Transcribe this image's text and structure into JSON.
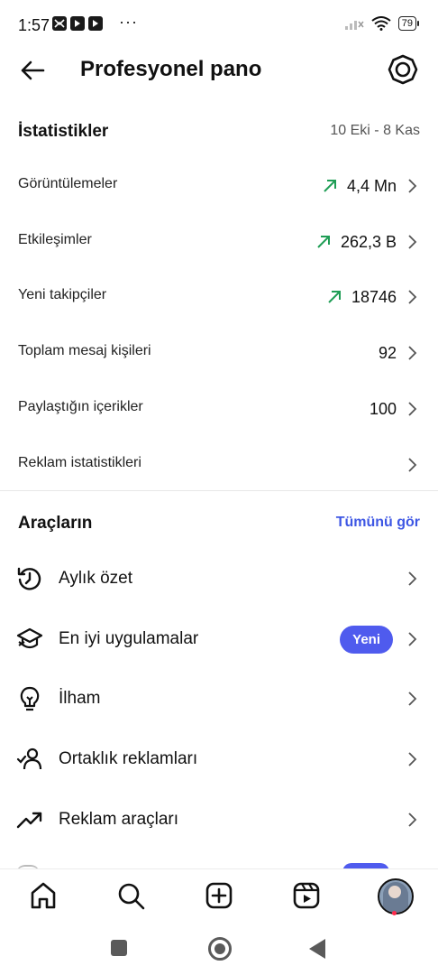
{
  "status_bar": {
    "time": "1:57",
    "dots": "···",
    "battery": "79"
  },
  "header": {
    "title": "Profesyonel pano"
  },
  "stats": {
    "title": "İstatistikler",
    "date_range": "10 Eki - 8 Kas",
    "rows": [
      {
        "label": "Görüntülemeler",
        "value": "4,4 Mn",
        "trend": "up"
      },
      {
        "label": "Etkileşimler",
        "value": "262,3 B",
        "trend": "up"
      },
      {
        "label": "Yeni takipçiler",
        "value": "18746",
        "trend": "up"
      },
      {
        "label": "Toplam mesaj kişileri",
        "value": "92",
        "trend": ""
      },
      {
        "label": "Paylaştığın içerikler",
        "value": "100",
        "trend": ""
      },
      {
        "label": "Reklam istatistikleri",
        "value": "",
        "trend": ""
      }
    ]
  },
  "tools": {
    "title": "Araçların",
    "see_all": "Tümünü gör",
    "items": [
      {
        "label": "Aylık özet",
        "icon": "history-icon"
      },
      {
        "label": "En iyi uygulamalar",
        "icon": "graduation-cap-icon",
        "badge": "Yeni"
      },
      {
        "label": "İlham",
        "icon": "lightbulb-icon"
      },
      {
        "label": "Ortaklık reklamları",
        "icon": "person-check-icon"
      },
      {
        "label": "Reklam araçları",
        "icon": "trending-up-icon"
      }
    ]
  },
  "tabbar": {
    "tabs": [
      "home-icon",
      "search-icon",
      "create-icon",
      "reels-icon",
      "profile-avatar"
    ]
  },
  "colors": {
    "accent": "#4f5bee",
    "link": "#3e57e4",
    "trend": "#1f9d55"
  }
}
